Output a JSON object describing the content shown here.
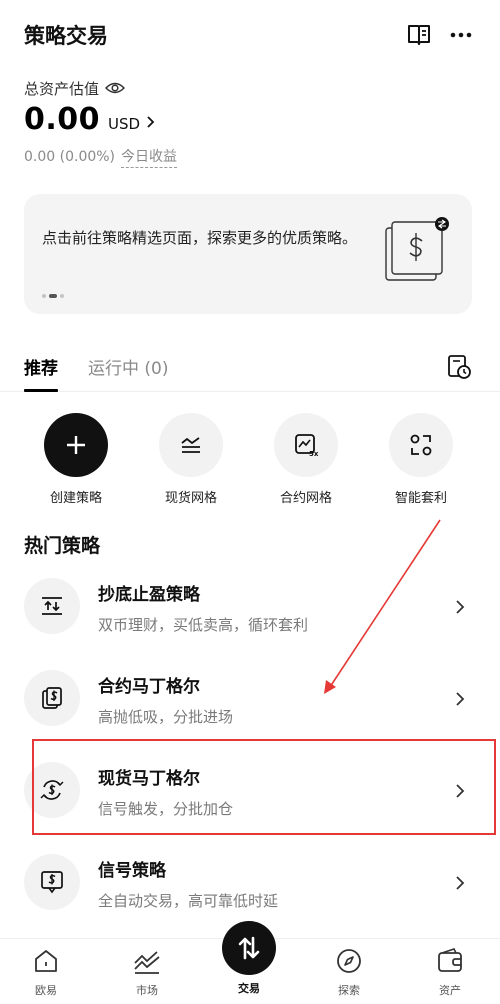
{
  "header": {
    "title": "策略交易",
    "book_icon": "book-icon",
    "more_icon": "more-icon"
  },
  "assets": {
    "label": "总资产估值",
    "value": "0.00",
    "currency": "USD",
    "pnl": "0.00 (0.00%)",
    "pnl_link": "今日收益"
  },
  "banner": {
    "text": "点击前往策略精选页面，探索更多的优质策略。",
    "active_slide": 2,
    "total_slides": 3
  },
  "tabs": {
    "recommended": "推荐",
    "running": "运行中 (0)"
  },
  "quick_actions": [
    {
      "label": "创建策略",
      "icon": "plus-icon"
    },
    {
      "label": "现货网格",
      "icon": "spot-grid-icon"
    },
    {
      "label": "合约网格",
      "icon": "futures-grid-icon"
    },
    {
      "label": "智能套利",
      "icon": "arbitrage-icon"
    }
  ],
  "section_title": "热门策略",
  "strategies": [
    {
      "name": "抄底止盈策略",
      "desc": "双币理财，买低卖高，循环套利",
      "icon": "dip-buy-icon"
    },
    {
      "name": "合约马丁格尔",
      "desc": "高抛低吸，分批进场",
      "icon": "futures-martingale-icon"
    },
    {
      "name": "现货马丁格尔",
      "desc": "信号触发，分批加仓",
      "icon": "spot-martingale-icon"
    },
    {
      "name": "信号策略",
      "desc": "全自动交易，高可靠低时延",
      "icon": "signal-icon"
    }
  ],
  "bottom_nav": [
    {
      "label": "欧易",
      "icon": "home-icon"
    },
    {
      "label": "市场",
      "icon": "market-icon"
    },
    {
      "label": "交易",
      "icon": "trade-icon"
    },
    {
      "label": "探索",
      "icon": "compass-icon"
    },
    {
      "label": "资产",
      "icon": "wallet-icon"
    }
  ],
  "colors": {
    "accent": "#111111",
    "annotation": "#e53935",
    "muted": "#8a8a8a"
  }
}
